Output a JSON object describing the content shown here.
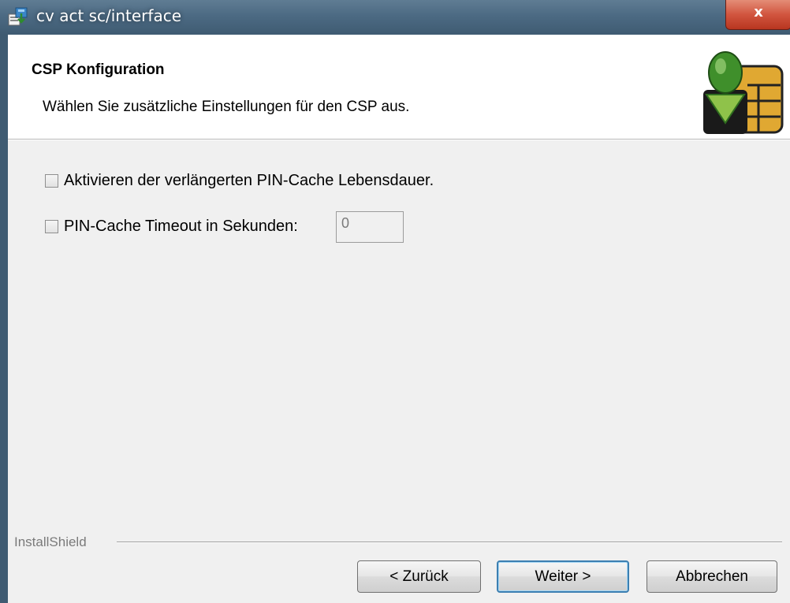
{
  "window": {
    "title": "cv act sc/interface",
    "close_label": "x",
    "icons": {
      "app": "installer-icon",
      "close": "close-icon",
      "logo": "smartcard-chip-logo"
    }
  },
  "banner": {
    "title": "CSP Konfiguration",
    "subtitle": "Wählen Sie zusätzliche Einstellungen für den CSP aus."
  },
  "options": {
    "extended_cache": {
      "label": "Aktivieren der verlängerten PIN-Cache Lebensdauer.",
      "checked": false
    },
    "timeout": {
      "label": "PIN-Cache Timeout in Sekunden:",
      "checked": false,
      "value": "0"
    }
  },
  "footer": {
    "group_label": "InstallShield",
    "back_label": "< Zurück",
    "next_label": "Weiter >",
    "cancel_label": "Abbrechen"
  },
  "colors": {
    "titlebar": "#4c6a83",
    "close_button": "#d1553f",
    "default_button_border": "#3c7fb1",
    "logo_green": "#3f8f2b",
    "logo_gold": "#e0a832"
  }
}
